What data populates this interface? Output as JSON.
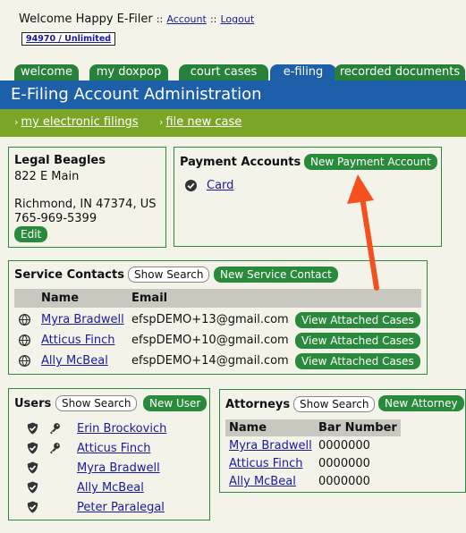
{
  "top": {
    "welcome": "Welcome Happy E-Filer",
    "sep1": "::",
    "account_link": "Account",
    "sep2": "::",
    "logout_link": "Logout",
    "account_badge": "94970 / Unlimited"
  },
  "tabs": [
    {
      "label": "welcome"
    },
    {
      "label": "my doxpop"
    },
    {
      "label": "court cases"
    },
    {
      "label": "e-filing"
    },
    {
      "label": "recorded documents"
    }
  ],
  "header": {
    "title": "E-Filing Account Administration"
  },
  "subnav": [
    {
      "label": "my electronic filings"
    },
    {
      "label": "file new case"
    }
  ],
  "firm": {
    "name": "Legal Beagles",
    "address1": "822 E Main",
    "address2": "Richmond, IN 47374, US",
    "phone": "765-969-5399",
    "edit_label": "Edit"
  },
  "payment": {
    "title": "Payment Accounts",
    "new_label": "New Payment Account",
    "items": [
      {
        "label": "Card"
      }
    ]
  },
  "service": {
    "title": "Service Contacts",
    "show_search": "Show Search",
    "new_label": "New Service Contact",
    "col_name": "Name",
    "col_email": "Email",
    "rows": [
      {
        "name": "Myra Bradwell",
        "email": "efspDEMO+13@gmail.com",
        "action": "View Attached Cases"
      },
      {
        "name": "Atticus Finch",
        "email": "efspDEMO+10@gmail.com",
        "action": "View Attached Cases"
      },
      {
        "name": "Ally McBeal",
        "email": "efspDEMO+14@gmail.com",
        "action": "View Attached Cases"
      }
    ]
  },
  "users": {
    "title": "Users",
    "show_search": "Show Search",
    "new_label": "New User",
    "rows": [
      {
        "name": "Erin Brockovich",
        "admin": true
      },
      {
        "name": "Atticus Finch",
        "admin": true
      },
      {
        "name": "Myra Bradwell",
        "admin": false
      },
      {
        "name": "Ally McBeal",
        "admin": false
      },
      {
        "name": "Peter Paralegal",
        "admin": false
      }
    ]
  },
  "attorneys": {
    "title": "Attorneys",
    "show_search": "Show Search",
    "new_label": "New Attorney",
    "col_name": "Name",
    "col_bar": "Bar Number",
    "rows": [
      {
        "name": "Myra Bradwell",
        "bar": "0000000"
      },
      {
        "name": "Atticus Finch",
        "bar": "0000000"
      },
      {
        "name": "Ally McBeal",
        "bar": "0000000"
      }
    ]
  },
  "annotation": {
    "color": "#f4511e"
  }
}
